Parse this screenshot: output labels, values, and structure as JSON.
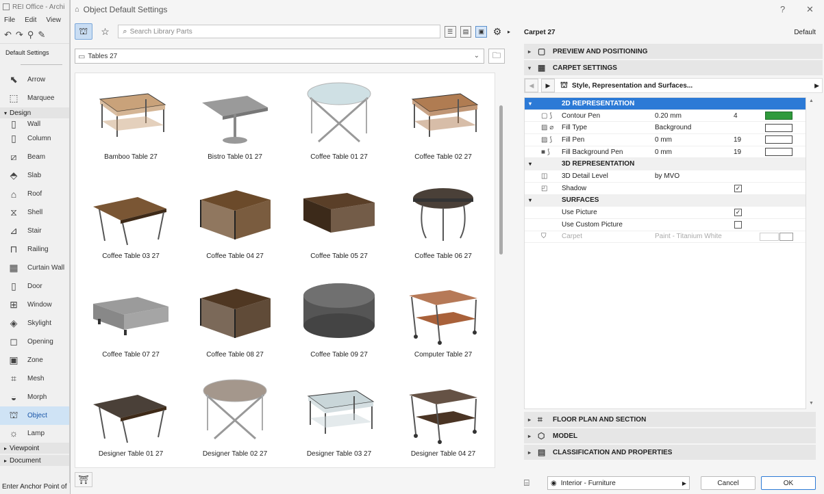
{
  "bg": {
    "title": "REI Office - Archi",
    "menus": [
      "File",
      "Edit",
      "View"
    ],
    "default_settings": "Default Settings",
    "tools": [
      {
        "label": "Arrow",
        "icon": "arrow-icon"
      },
      {
        "label": "Marquee",
        "icon": "marquee-icon"
      }
    ],
    "design_group": "Design",
    "design_tools": [
      {
        "label": "Wall",
        "icon": "wall-icon"
      },
      {
        "label": "Column",
        "icon": "column-icon"
      },
      {
        "label": "Beam",
        "icon": "beam-icon"
      },
      {
        "label": "Slab",
        "icon": "slab-icon"
      },
      {
        "label": "Roof",
        "icon": "roof-icon"
      },
      {
        "label": "Shell",
        "icon": "shell-icon"
      },
      {
        "label": "Stair",
        "icon": "stair-icon"
      },
      {
        "label": "Railing",
        "icon": "railing-icon"
      },
      {
        "label": "Curtain Wall",
        "icon": "curtain-wall-icon"
      },
      {
        "label": "Door",
        "icon": "door-icon"
      },
      {
        "label": "Window",
        "icon": "window-icon"
      },
      {
        "label": "Skylight",
        "icon": "skylight-icon"
      },
      {
        "label": "Opening",
        "icon": "opening-icon"
      },
      {
        "label": "Zone",
        "icon": "zone-icon"
      },
      {
        "label": "Mesh",
        "icon": "mesh-icon"
      },
      {
        "label": "Morph",
        "icon": "morph-icon"
      },
      {
        "label": "Object",
        "icon": "object-icon",
        "active": true
      },
      {
        "label": "Lamp",
        "icon": "lamp-icon"
      }
    ],
    "viewpoint_group": "Viewpoint",
    "document_group": "Document",
    "status": "Enter Anchor Point of"
  },
  "dialog": {
    "title": "Object Default Settings",
    "help": "?",
    "close": "✕"
  },
  "library": {
    "search_placeholder": "Search Library Parts",
    "folder": "Tables 27",
    "items": [
      {
        "label": "Bamboo Table 27",
        "kind": "coffee",
        "color": "#c9a27a"
      },
      {
        "label": "Bistro Table 01 27",
        "kind": "bistro",
        "color": "#9a9a9a"
      },
      {
        "label": "Coffee Table 01 27",
        "kind": "round-glass",
        "color": "#a9c7cf"
      },
      {
        "label": "Coffee Table 02 27",
        "kind": "coffee",
        "color": "#b07c52"
      },
      {
        "label": "Coffee Table 03 27",
        "kind": "wood-top",
        "color": "#7a5634"
      },
      {
        "label": "Coffee Table 04 27",
        "kind": "cube",
        "color": "#6b4a2a"
      },
      {
        "label": "Coffee Table 05 27",
        "kind": "box",
        "color": "#5a3f28"
      },
      {
        "label": "Coffee Table 06 27",
        "kind": "round-top",
        "color": "#4a4038"
      },
      {
        "label": "Coffee Table 07 27",
        "kind": "ottoman",
        "color": "#9b9b9b"
      },
      {
        "label": "Coffee Table 08 27",
        "kind": "cube",
        "color": "#4f3722"
      },
      {
        "label": "Coffee Table 09 27",
        "kind": "pouf",
        "color": "#555555"
      },
      {
        "label": "Computer Table 27",
        "kind": "cart",
        "color": "#a9613a"
      },
      {
        "label": "Designer Table 01 27",
        "kind": "wood-top",
        "color": "#4a4038"
      },
      {
        "label": "Designer Table 02 27",
        "kind": "round-glass",
        "color": "#5a4330"
      },
      {
        "label": "Designer Table 03 27",
        "kind": "coffee",
        "color": "#c9d6d9"
      },
      {
        "label": "Designer Table 04 27",
        "kind": "cart",
        "color": "#4a3424"
      }
    ]
  },
  "props": {
    "object_name": "Carpet 27",
    "default_label": "Default",
    "preview_section": "PREVIEW AND POSITIONING",
    "carpet_section": "CARPET SETTINGS",
    "nav_label": "Style, Representation and Surfaces...",
    "rows": [
      {
        "type": "hdrsel",
        "name": "2D REPRESENTATION"
      },
      {
        "type": "row",
        "icon": "contour-pen-icon",
        "glyph": "▢ ⟆",
        "name": "Contour Pen",
        "val": "0.20 mm",
        "num": "4",
        "swatch": "#2f9a3c"
      },
      {
        "type": "row",
        "icon": "fill-type-icon",
        "glyph": "▨ ⌀",
        "name": "Fill Type",
        "val": "Background",
        "num": "",
        "swatch": "#ffffff"
      },
      {
        "type": "row",
        "icon": "fill-pen-icon",
        "glyph": "▨ ⟆",
        "name": "Fill Pen",
        "val": "0 mm",
        "num": "19",
        "swatch": "#ffffff"
      },
      {
        "type": "row",
        "icon": "fill-background-pen-icon",
        "glyph": "■ ⟆",
        "name": "Fill Background Pen",
        "val": "0 mm",
        "num": "19",
        "swatch": "#ffffff"
      },
      {
        "type": "hdr",
        "name": "3D REPRESENTATION"
      },
      {
        "type": "row",
        "icon": "detail-level-icon",
        "glyph": "◫",
        "name": "3D Detail Level",
        "val": "by MVO",
        "num": ""
      },
      {
        "type": "check",
        "icon": "shadow-icon",
        "glyph": "◰",
        "name": "Shadow",
        "checked": true
      },
      {
        "type": "hdr",
        "name": "SURFACES"
      },
      {
        "type": "check",
        "icon": "",
        "glyph": "",
        "name": "Use Picture",
        "checked": true
      },
      {
        "type": "check",
        "icon": "",
        "glyph": "",
        "name": "Use Custom Picture",
        "checked": false
      },
      {
        "type": "dis",
        "icon": "surface-icon",
        "glyph": "⛉",
        "name": "Carpet",
        "val": "Paint - Titanium White"
      }
    ],
    "floor_section": "FLOOR PLAN AND SECTION",
    "model_section": "MODEL",
    "class_section": "CLASSIFICATION AND PROPERTIES",
    "favorite": "Interior - Furniture",
    "cancel": "Cancel",
    "ok": "OK"
  }
}
